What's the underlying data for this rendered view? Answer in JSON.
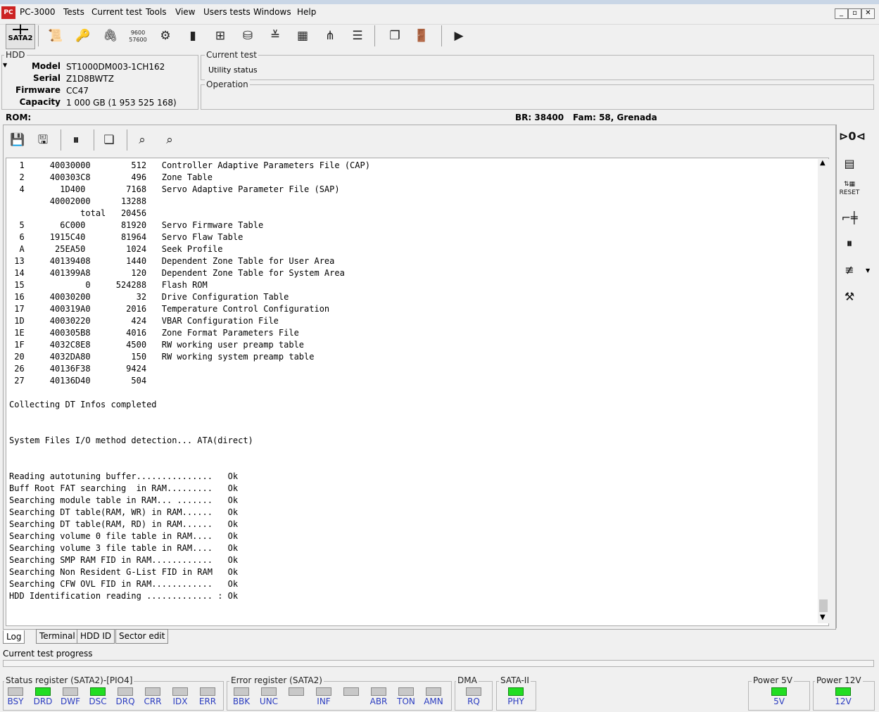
{
  "window": {
    "title": "PC-3000",
    "logo_text": "PC"
  },
  "menu": [
    "Tests",
    "Current test",
    "Tools",
    "View",
    "Users tests",
    "Windows",
    "Help"
  ],
  "window_buttons": [
    "_",
    "▫",
    "✕"
  ],
  "toolbar": {
    "sata_label": "SATA2"
  },
  "hdd": {
    "group_title": "HDD",
    "model_label": "Model",
    "model": "ST1000DM003-1CH162",
    "serial_label": "Serial",
    "serial": "Z1D8BWTZ",
    "firmware_label": "Firmware",
    "firmware": "CC47",
    "capacity_label": "Capacity",
    "capacity": "1 000 GB (1 953 525 168)"
  },
  "current_test": {
    "group_title": "Current test",
    "value": "Utility status"
  },
  "operation": {
    "group_title": "Operation"
  },
  "info_bar": {
    "rom": "ROM:",
    "br": "BR: 38400",
    "fam": "Fam: 58, Grenada"
  },
  "log_lines": [
    "  1     40030000        512   Controller Adaptive Parameters File (CAP)",
    "  2     400303C8        496   Zone Table",
    "  4       1D400        7168   Servo Adaptive Parameter File (SAP)",
    "        40002000      13288",
    "              total   20456",
    "  5       6C000       81920   Servo Firmware Table",
    "  6     1915C40       81964   Servo Flaw Table",
    "  A      25EA50        1024   Seek Profile",
    " 13     40139408       1440   Dependent Zone Table for User Area",
    " 14     401399A8        120   Dependent Zone Table for System Area",
    " 15            0     524288   Flash ROM",
    " 16     40030200         32   Drive Configuration Table",
    " 17     400319A0       2016   Temperature Control Configuration",
    " 1D     40030220        424   VBAR Configuration File",
    " 1E     400305B8       4016   Zone Format Parameters File",
    " 1F     4032C8E8       4500   RW working user preamp table",
    " 20     4032DA80        150   RW working system preamp table",
    " 26     40136F38       9424",
    " 27     40136D40        504",
    "",
    "Collecting DT Infos completed",
    "",
    "",
    "System Files I/O method detection... ATA(direct)",
    "",
    "",
    "Reading autotuning buffer...............   Ok",
    "Buff Root FAT searching  in RAM.........   Ok",
    "Searching module table in RAM... .......   Ok",
    "Searching DT table(RAM, WR) in RAM......   Ok",
    "Searching DT table(RAM, RD) in RAM......   Ok",
    "Searching volume 0 file table in RAM....   Ok",
    "Searching volume 3 file table in RAM....   Ok",
    "Searching SMP RAM FID in RAM............   Ok",
    "Searching Non Resident G-List FID in RAM   Ok",
    "Searching CFW OVL FID in RAM............   Ok",
    "HDD Identification reading ............. : Ok"
  ],
  "tabs": [
    "Log",
    "Terminal",
    "HDD ID",
    "Sector edit"
  ],
  "progress": {
    "label": "Current test progress",
    "value": 0
  },
  "status_register": {
    "title": "Status register (SATA2)-[PIO4]",
    "leds": [
      {
        "label": "BSY",
        "on": false
      },
      {
        "label": "DRD",
        "on": true
      },
      {
        "label": "DWF",
        "on": false
      },
      {
        "label": "DSC",
        "on": true
      },
      {
        "label": "DRQ",
        "on": false
      },
      {
        "label": "CRR",
        "on": false
      },
      {
        "label": "IDX",
        "on": false
      },
      {
        "label": "ERR",
        "on": false
      }
    ]
  },
  "error_register": {
    "title": "Error register (SATA2)",
    "leds": [
      {
        "label": "BBK",
        "on": false
      },
      {
        "label": "UNC",
        "on": false
      },
      {
        "label": "",
        "on": false
      },
      {
        "label": "INF",
        "on": false
      },
      {
        "label": "",
        "on": false
      },
      {
        "label": "ABR",
        "on": false
      },
      {
        "label": "TON",
        "on": false
      },
      {
        "label": "AMN",
        "on": false
      }
    ]
  },
  "dma": {
    "title": "DMA",
    "leds": [
      {
        "label": "RQ",
        "on": false
      }
    ]
  },
  "sata": {
    "title": "SATA-II",
    "leds": [
      {
        "label": "PHY",
        "on": true
      }
    ]
  },
  "power5": {
    "title": "Power 5V",
    "leds": [
      {
        "label": "5V",
        "on": true
      }
    ]
  },
  "power12": {
    "title": "Power 12V",
    "leds": [
      {
        "label": "12V",
        "on": true
      }
    ]
  },
  "colors": {
    "led_on": "#22dd22",
    "led_off": "#c8c8c8",
    "led_label": "#2a3cc0"
  }
}
